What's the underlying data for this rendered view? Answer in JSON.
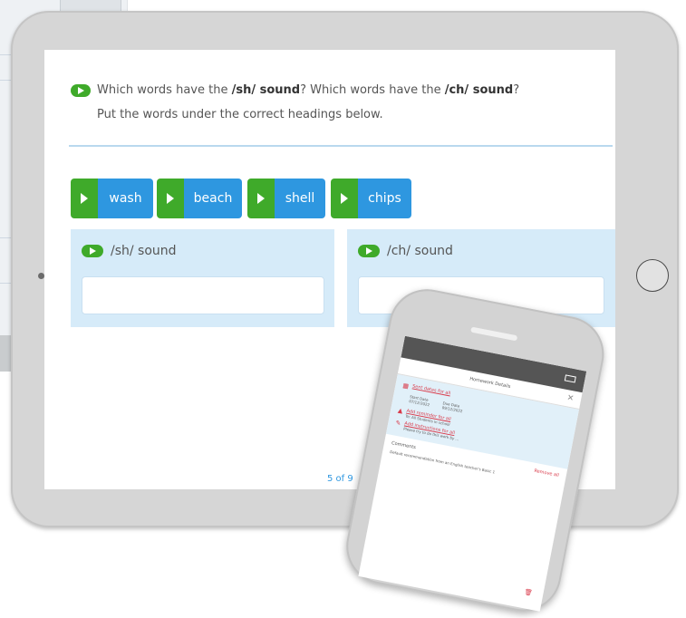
{
  "question": {
    "line1_a": "Which words have the ",
    "line1_sh": "/sh/ sound",
    "line1_b": "? Which words have the ",
    "line1_ch": "/ch/ sound",
    "line1_c": "?",
    "line2": "Put the words under the correct headings below."
  },
  "word_chips": [
    {
      "label": "wash"
    },
    {
      "label": "beach"
    },
    {
      "label": "shell"
    },
    {
      "label": "chips"
    }
  ],
  "drop_zones": [
    {
      "title": "/sh/ sound"
    },
    {
      "title": "/ch/ sound"
    }
  ],
  "pager": "5 of 9",
  "colors": {
    "play_green": "#3faa2a",
    "chip_blue": "#2e97e0",
    "zone_bg": "#d6ebf9",
    "link_red": "#d93a4a"
  },
  "phone": {
    "title": "Homework Details",
    "item1_link": "Sent dates for all",
    "grid_a1": "Start Date",
    "grid_a2": "07/12/2022",
    "grid_b1": "Due Date",
    "grid_b2": "09/12/2022",
    "item2_link": "Add reminder for all",
    "item2_sub": "To: All Students in school",
    "item3_link": "Add instructions for all",
    "item3_sub": "Please try to do this work by ...",
    "comments_label": "Comments",
    "remove_all": "Remove all",
    "text": "Default recommendation from an English teacher's Basic 1"
  }
}
